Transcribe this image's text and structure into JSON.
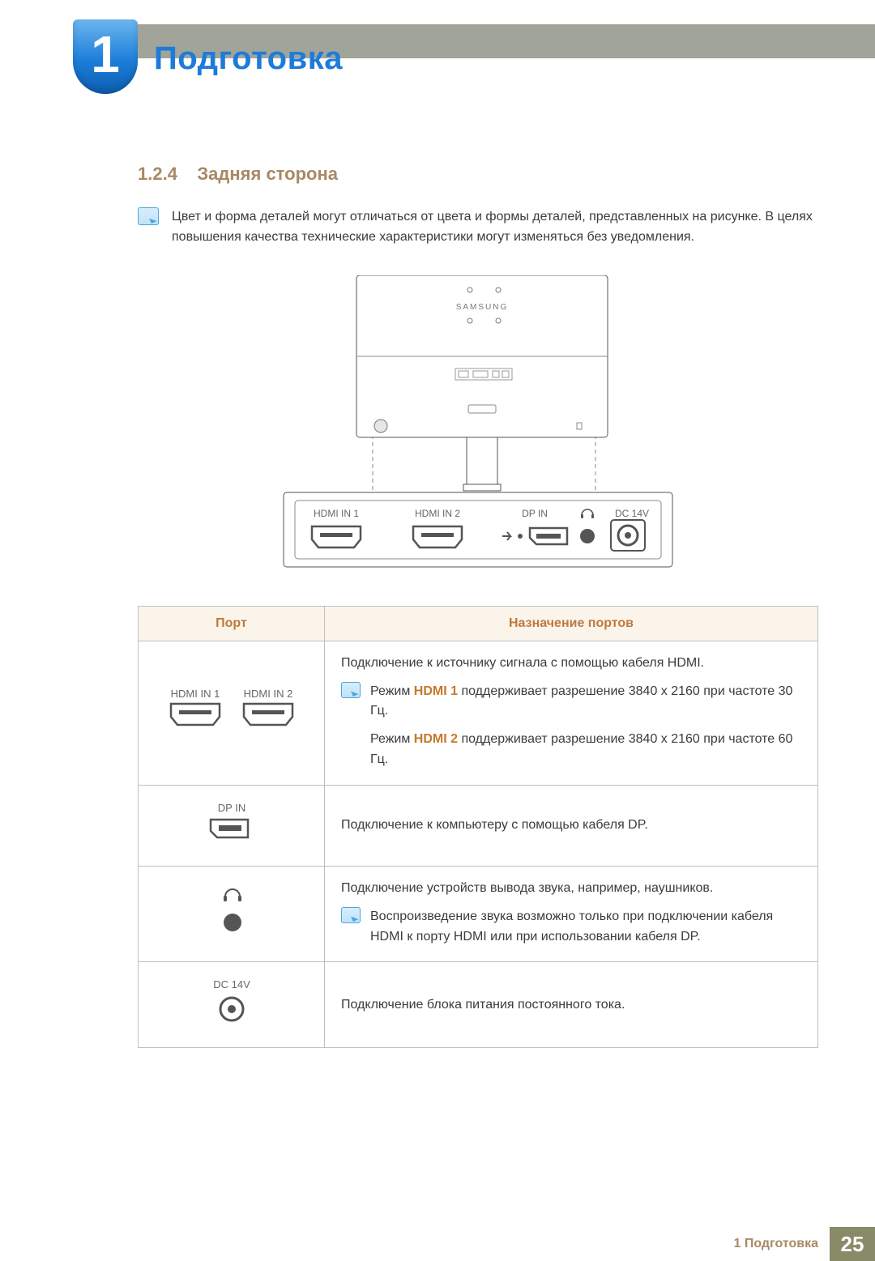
{
  "chapter": {
    "num": "1",
    "title": "Подготовка"
  },
  "section": {
    "num": "1.2.4",
    "title": "Задняя сторона"
  },
  "top_note": "Цвет и форма деталей могут отличаться от цвета и формы деталей, представленных на рисунке. В целях повышения качества технические характеристики могут изменяться без уведомления.",
  "figure": {
    "brand": "SAMSUNG",
    "strip_labels": {
      "hdmi1": "HDMI IN 1",
      "hdmi2": "HDMI IN 2",
      "dp": "DP IN",
      "dc": "DC 14V"
    }
  },
  "table": {
    "headers": {
      "port": "Порт",
      "desc": "Назначение портов"
    },
    "rows": [
      {
        "port_labels": [
          "HDMI IN 1",
          "HDMI IN 2"
        ],
        "desc_main": "Подключение к источнику сигнала с помощью кабеля HDMI.",
        "note_lines": [
          {
            "pre": "Режим ",
            "hl": "HDMI 1",
            "post": " поддерживает разрешение 3840 x 2160 при частоте 30 Гц."
          },
          {
            "pre": "Режим ",
            "hl": "HDMI 2",
            "post": " поддерживает разрешение 3840 x 2160 при частоте 60 Гц."
          }
        ]
      },
      {
        "port_labels": [
          "DP IN"
        ],
        "desc_main": "Подключение к компьютеру с помощью кабеля DP."
      },
      {
        "port_headphone": true,
        "desc_main": "Подключение устройств вывода звука, например, наушников.",
        "note_plain": "Воспроизведение звука возможно только при подключении кабеля HDMI к порту HDMI или при использовании кабеля DP."
      },
      {
        "port_labels": [
          "DC 14V"
        ],
        "desc_main": "Подключение блока питания постоянного тока."
      }
    ]
  },
  "footer": {
    "label": "1 Подготовка",
    "page": "25"
  }
}
